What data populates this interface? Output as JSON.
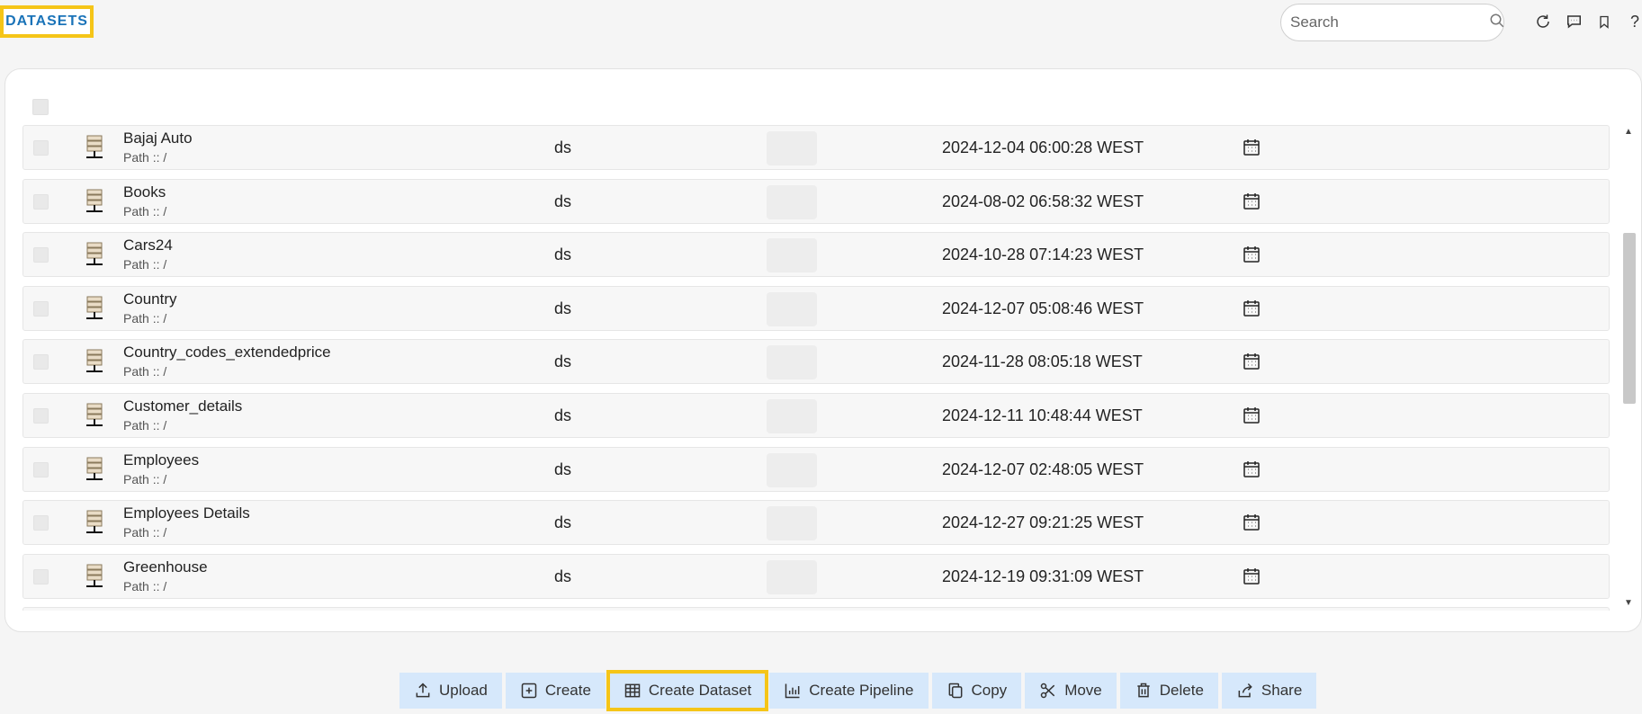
{
  "header": {
    "title": "DATASETS",
    "search_placeholder": "Search",
    "icons": [
      "refresh-icon",
      "comment-icon",
      "bookmark-icon",
      "help-icon"
    ],
    "help_glyph": "?"
  },
  "datasets": [
    {
      "name": "Bajaj Auto",
      "path": "Path :: /",
      "type": "ds",
      "modified": "2024-12-04 06:00:28 WEST"
    },
    {
      "name": "Books",
      "path": "Path :: /",
      "type": "ds",
      "modified": "2024-08-02 06:58:32 WEST"
    },
    {
      "name": "Cars24",
      "path": "Path :: /",
      "type": "ds",
      "modified": "2024-10-28 07:14:23 WEST"
    },
    {
      "name": "Country",
      "path": "Path :: /",
      "type": "ds",
      "modified": "2024-12-07 05:08:46 WEST"
    },
    {
      "name": "Country_codes_extendedprice",
      "path": "Path :: /",
      "type": "ds",
      "modified": "2024-11-28 08:05:18 WEST"
    },
    {
      "name": "Customer_details",
      "path": "Path :: /",
      "type": "ds",
      "modified": "2024-12-11 10:48:44 WEST"
    },
    {
      "name": "Employees",
      "path": "Path :: /",
      "type": "ds",
      "modified": "2024-12-07 02:48:05 WEST"
    },
    {
      "name": "Employees Details",
      "path": "Path :: /",
      "type": "ds",
      "modified": "2024-12-27 09:21:25 WEST"
    },
    {
      "name": "Greenhouse",
      "path": "Path :: /",
      "type": "ds",
      "modified": "2024-12-19 09:31:09 WEST"
    }
  ],
  "toolbar": {
    "upload": "Upload",
    "create": "Create",
    "create_dataset": "Create Dataset",
    "create_pipeline": "Create Pipeline",
    "copy": "Copy",
    "move": "Move",
    "delete": "Delete",
    "share": "Share"
  },
  "colors": {
    "accent": "#1a73b8",
    "highlight": "#f5c518",
    "toolbar_button": "#d6e8fb"
  }
}
